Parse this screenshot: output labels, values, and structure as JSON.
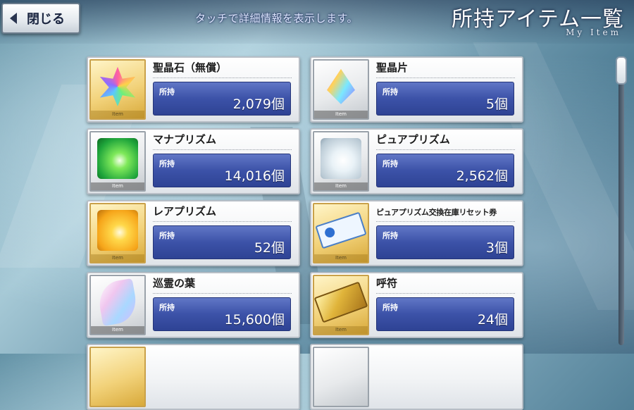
{
  "header": {
    "close_label": "閉じる",
    "hint": "タッチで詳細情報を表示します。",
    "title": "所持アイテム一覧",
    "subtitle": "My Item"
  },
  "items": [
    {
      "name": "聖晶石（無償）",
      "count_label": "所持",
      "count": "2,079個",
      "thumb_tag": "Item",
      "icon": "saint-quartz-star-icon",
      "frame": "gold"
    },
    {
      "name": "聖晶片",
      "count_label": "所持",
      "count": "5個",
      "thumb_tag": "Item",
      "icon": "quartz-fragment-icon",
      "frame": "silver"
    },
    {
      "name": "マナプリズム",
      "count_label": "所持",
      "count": "14,016個",
      "thumb_tag": "Item",
      "icon": "mana-prism-cube-icon",
      "frame": "silver"
    },
    {
      "name": "ピュアプリズム",
      "count_label": "所持",
      "count": "2,562個",
      "thumb_tag": "Item",
      "icon": "pure-prism-cube-icon",
      "frame": "silver"
    },
    {
      "name": "レアプリズム",
      "count_label": "所持",
      "count": "52個",
      "thumb_tag": "Item",
      "icon": "rare-prism-cube-icon",
      "frame": "gold"
    },
    {
      "name": "ピュアプリズム交換在庫リセット券",
      "count_label": "所持",
      "count": "3個",
      "thumb_tag": "Item",
      "icon": "reset-ticket-icon",
      "frame": "gold"
    },
    {
      "name": "巡霊の葉",
      "count_label": "所持",
      "count": "15,600個",
      "thumb_tag": "Item",
      "icon": "spirit-leaf-icon",
      "frame": "silver"
    },
    {
      "name": "呼符",
      "count_label": "所持",
      "count": "24個",
      "thumb_tag": "Item",
      "icon": "summon-ticket-icon",
      "frame": "gold"
    },
    {
      "name": "",
      "count_label": "",
      "count": "",
      "thumb_tag": "",
      "icon": "partial-item-icon",
      "frame": "gold"
    },
    {
      "name": "",
      "count_label": "",
      "count": "",
      "thumb_tag": "",
      "icon": "partial-item-icon",
      "frame": "silver"
    }
  ]
}
